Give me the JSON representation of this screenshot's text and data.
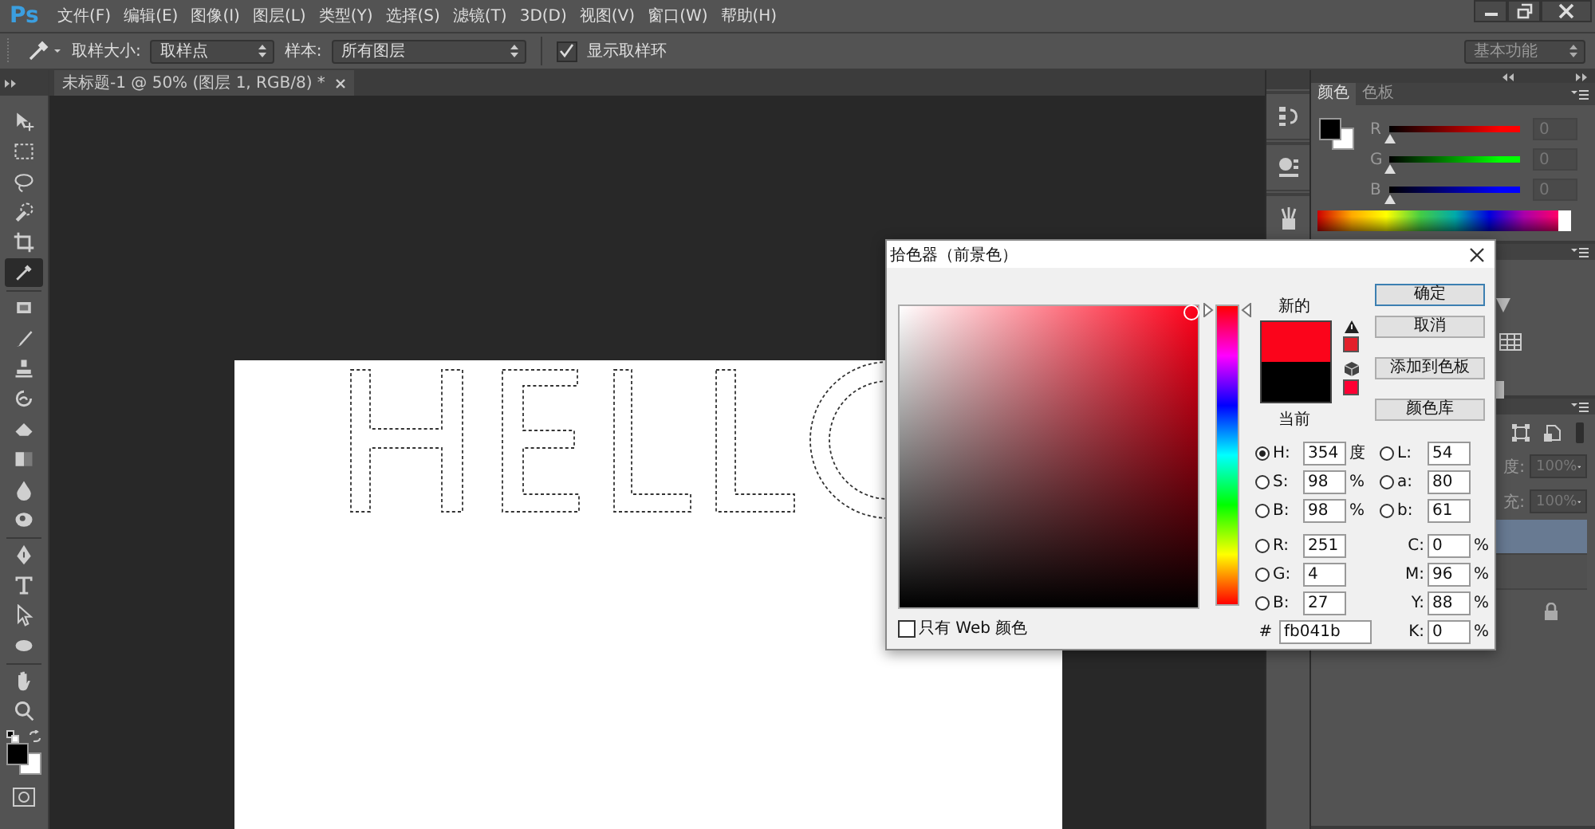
{
  "app": {
    "logo": "Ps"
  },
  "menu_bar": {
    "items": [
      "文件(F)",
      "编辑(E)",
      "图像(I)",
      "图层(L)",
      "类型(Y)",
      "选择(S)",
      "滤镜(T)",
      "3D(D)",
      "视图(V)",
      "窗口(W)",
      "帮助(H)"
    ]
  },
  "options_bar": {
    "sample_size_label": "取样大小:",
    "sample_size": "取样点",
    "sample_label": "样本:",
    "sample": "所有图层",
    "show_ring": {
      "label": "显示取样环",
      "checked": true
    },
    "workspace": "基本功能"
  },
  "document_tab": {
    "title": "未标题-1 @ 50% (图层 1, RGB/8) *"
  },
  "toolbar": {
    "tools": [
      {
        "kind": "move",
        "selected": false
      },
      {
        "kind": "marquee",
        "selected": false
      },
      {
        "kind": "lasso",
        "selected": false
      },
      {
        "kind": "quick-select",
        "selected": false
      },
      {
        "kind": "crop",
        "selected": false
      },
      {
        "kind": "eyedropper",
        "selected": true
      },
      {
        "kind": "healing",
        "selected": false
      },
      {
        "kind": "brush",
        "selected": false
      },
      {
        "kind": "stamp",
        "selected": false
      },
      {
        "kind": "history",
        "selected": false
      },
      {
        "kind": "eraser",
        "selected": false
      },
      {
        "kind": "gradient",
        "selected": false
      },
      {
        "kind": "blur",
        "selected": false
      },
      {
        "kind": "dodge",
        "selected": false
      },
      {
        "kind": "pen",
        "selected": false
      },
      {
        "kind": "type",
        "selected": false
      },
      {
        "kind": "path-select",
        "selected": false
      },
      {
        "kind": "shape",
        "selected": false
      },
      {
        "kind": "hand",
        "selected": false
      },
      {
        "kind": "zoom",
        "selected": false
      }
    ]
  },
  "color_panel": {
    "tabs": [
      {
        "label": "颜色",
        "selected": true
      },
      {
        "label": "色板",
        "selected": false
      }
    ],
    "channels": [
      {
        "label": "R",
        "level": 0,
        "value": "0",
        "color": "#ff0000"
      },
      {
        "label": "G",
        "level": 0,
        "value": "0",
        "color": "#00ff00"
      },
      {
        "label": "B",
        "level": 0,
        "value": "0",
        "color": "#0000ff"
      }
    ]
  },
  "layers_panel": {
    "opacity_label": "度:",
    "opacity": "100%",
    "fill_label": "充:",
    "fill": "100%",
    "layers": [
      {
        "selected": true
      },
      {
        "selected": false
      }
    ]
  },
  "dialog": {
    "title": "拾色器（前景色）",
    "new_label": "新的",
    "current_label": "当前",
    "comparison": [
      {
        "color": "#fb041b"
      },
      {
        "color": "#000000"
      }
    ],
    "warnings": [
      {
        "color": "#e3202a"
      },
      {
        "color": "#ff0033"
      }
    ],
    "hue_slider": {
      "level": 0.983
    },
    "buttons": [
      {
        "label": "确定",
        "selected": true
      },
      {
        "label": "取消",
        "selected": false
      },
      {
        "label": "添加到色板",
        "selected": false
      },
      {
        "label": "颜色库",
        "selected": false
      }
    ],
    "fields_left": [
      {
        "kind": "radio",
        "label": "H:",
        "value": "354",
        "unit": "度",
        "selected": true
      },
      {
        "kind": "radio",
        "label": "S:",
        "value": "98",
        "unit": "%",
        "selected": false
      },
      {
        "kind": "radio",
        "label": "B:",
        "value": "98",
        "unit": "%",
        "selected": false
      },
      {
        "kind": "radio",
        "label": "R:",
        "value": "251",
        "selected": false
      },
      {
        "kind": "radio",
        "label": "G:",
        "value": "4",
        "selected": false
      },
      {
        "kind": "radio",
        "label": "B:",
        "value": "27",
        "selected": false
      },
      {
        "kind": "hex",
        "label": "#",
        "value": "fb041b"
      }
    ],
    "fields_right": [
      {
        "kind": "radio",
        "label": "L:",
        "value": "54",
        "selected": false
      },
      {
        "kind": "radio",
        "label": "a:",
        "value": "80",
        "selected": false
      },
      {
        "kind": "radio",
        "label": "b:",
        "value": "61",
        "selected": false
      },
      {
        "kind": "plain",
        "label": "C:",
        "value": "0",
        "unit": "%"
      },
      {
        "kind": "plain",
        "label": "M:",
        "value": "96",
        "unit": "%"
      },
      {
        "kind": "plain",
        "label": "Y:",
        "value": "88",
        "unit": "%"
      },
      {
        "kind": "plain",
        "label": "K:",
        "value": "0",
        "unit": "%"
      }
    ],
    "web_only": {
      "label": "只有 Web 颜色",
      "checked": false
    }
  }
}
